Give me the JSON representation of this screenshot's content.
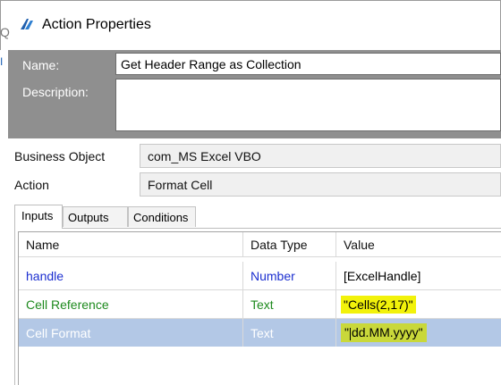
{
  "window": {
    "title": "Action Properties",
    "icon": "blueprism-icon",
    "background_fragments": [
      "Q",
      "I"
    ]
  },
  "header": {
    "name_label": "Name:",
    "name_value": "Get Header Range as Collection",
    "description_label": "Description:",
    "description_value": ""
  },
  "details": {
    "business_object_label": "Business Object",
    "business_object_value": "com_MS Excel VBO",
    "action_label": "Action",
    "action_value": "Format Cell"
  },
  "tabs": [
    {
      "label": "Inputs",
      "active": true
    },
    {
      "label": "Outputs",
      "active": false
    },
    {
      "label": "Conditions",
      "active": false
    }
  ],
  "grid": {
    "columns": [
      "Name",
      "Data Type",
      "Value"
    ],
    "rows": [
      {
        "name": "handle",
        "type": "Number",
        "value": "[ExcelHandle]",
        "color": "#1c2fd0"
      },
      {
        "name": "Cell Reference",
        "type": "Text",
        "value": "\"Cells(2,17)\"",
        "color": "#1e8a1e"
      },
      {
        "name": "Cell Format",
        "type": "Text",
        "value_open_quote": "\"",
        "value_rest": "dd.MM.yyyy\"",
        "selected": true
      }
    ]
  },
  "colors": {
    "header_panel": "#8f8f8f",
    "selected_row": "#b3c8e6",
    "highlight": "#f2f20a"
  }
}
